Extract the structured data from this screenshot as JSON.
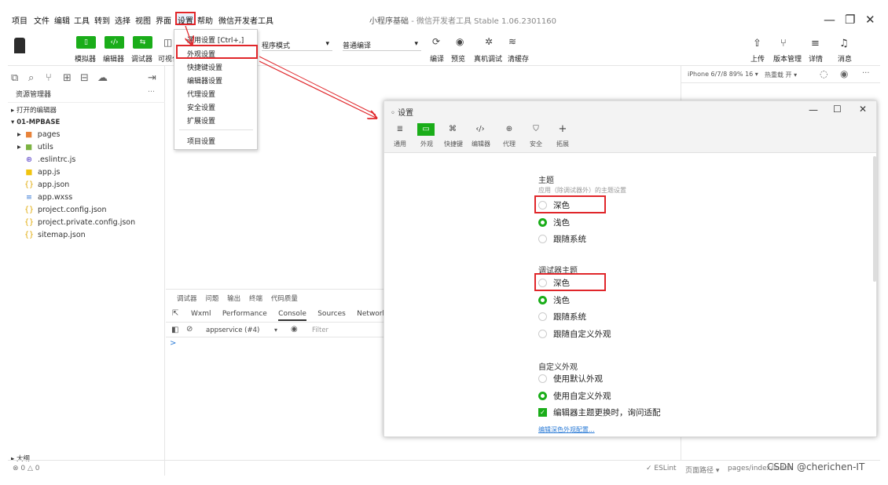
{
  "menubar": {
    "items": [
      "项目",
      "文件",
      "编辑",
      "工具",
      "转到",
      "选择",
      "视图",
      "界面",
      "设置",
      "帮助",
      "微信开发者工具"
    ],
    "title": "小程序基础",
    "subtitle": "- 微信开发者工具 Stable 1.06.2301160"
  },
  "toolbar": {
    "btn_labels": [
      "模拟器",
      "编辑器",
      "调试器",
      "可视化"
    ],
    "mode": "程序模式",
    "compile": "普通编译",
    "actions": [
      "编译",
      "预览",
      "真机调试",
      "清缓存"
    ],
    "right": [
      "上传",
      "版本管理",
      "详情",
      "消息"
    ]
  },
  "settings_menu": {
    "items": [
      "通用设置 [Ctrl+,]",
      "外观设置",
      "快捷键设置",
      "编辑器设置",
      "代理设置",
      "安全设置",
      "扩展设置",
      "项目设置"
    ]
  },
  "sidebar": {
    "header": "资源管理器",
    "more": "···",
    "open_editors": "打开的编辑器",
    "project": "01-MPBASE",
    "files": [
      "pages",
      "utils",
      ".eslintrc.js",
      "app.js",
      "app.json",
      "app.wxss",
      "project.config.json",
      "project.private.config.json",
      "sitemap.json"
    ],
    "outline": "大纲"
  },
  "simulator": {
    "device": "iPhone 6/7/8 89% 16 ▾",
    "hotreload": "热重载 开 ▾"
  },
  "devtools": {
    "top_tabs": [
      "调试器",
      "问题",
      "输出",
      "终端",
      "代码质量"
    ],
    "tabs": [
      "Wxml",
      "Performance",
      "Console",
      "Sources",
      "Network"
    ],
    "context": "appservice (#4)",
    "filter_placeholder": "Filter",
    "prompt": ">"
  },
  "dialog": {
    "title": "设置",
    "tabs": [
      "通用",
      "外观",
      "快捷键",
      "编辑器",
      "代理",
      "安全",
      "拓展"
    ],
    "theme_title": "主题",
    "theme_desc": "应用（除调试器外）的主题设置",
    "theme_opts": [
      "深色",
      "浅色",
      "跟随系统"
    ],
    "debug_title": "调试器主题",
    "debug_opts": [
      "深色",
      "浅色",
      "跟随系统",
      "跟随自定义外观"
    ],
    "custom_title": "自定义外观",
    "custom_opts": [
      "使用默认外观",
      "使用自定义外观"
    ],
    "checkbox_label": "编辑器主题更换时，询问适配",
    "link": "编辑深色外观配置..."
  },
  "status": {
    "left": "⊗ 0 △ 0",
    "eslint": "✓ ESLint",
    "path_label": "页面路径 ▾",
    "path": "pages/index/index",
    "watermark": "CSDN @cherichen-IT"
  },
  "colors": {
    "accent": "#1aad19",
    "highlight": "#e0262a",
    "blue": "#2b7bd6"
  }
}
